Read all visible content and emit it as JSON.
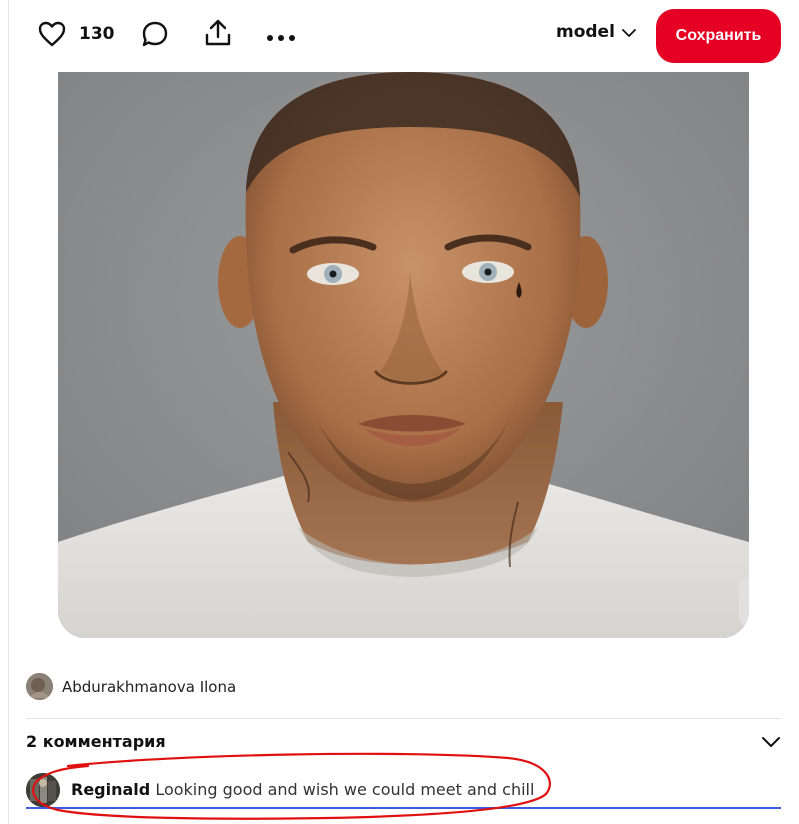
{
  "toolbar": {
    "like_count": "130",
    "icons": [
      "heart-icon",
      "comment-icon",
      "share-icon",
      "more-icon"
    ],
    "board_name": "model",
    "save_label": "Сохранить"
  },
  "author": {
    "name": "Abdurakhmanova Ilona"
  },
  "comments": {
    "title": "2 комментария",
    "items": [
      {
        "author": "Reginald",
        "text": "Looking good and wish we could meet and chill"
      }
    ]
  },
  "colors": {
    "save_button": "#e60023",
    "annotation_ellipse": "#e01010",
    "comment_underline": "#3b5bdb"
  }
}
